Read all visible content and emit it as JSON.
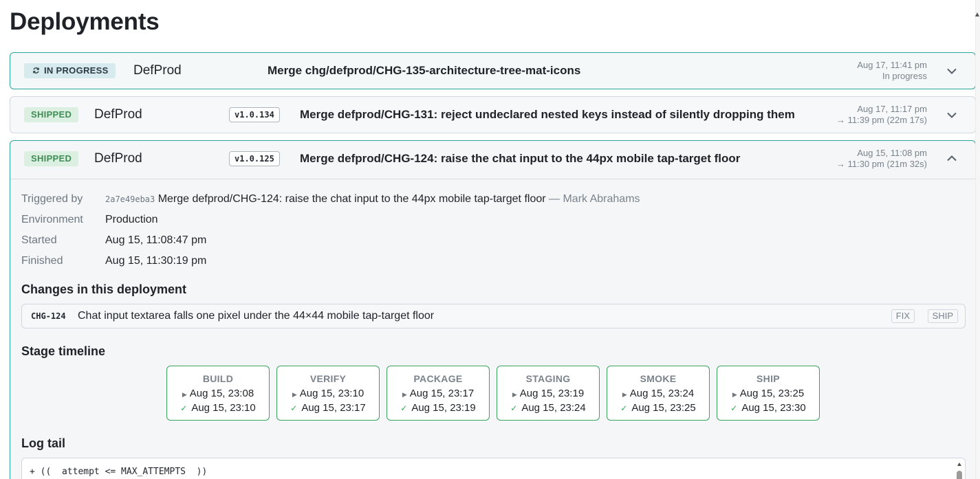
{
  "page": {
    "title": "Deployments"
  },
  "deployments": [
    {
      "status": "IN PROGRESS",
      "project": "DefProd",
      "version": "",
      "message": "Merge chg/defprod/CHG-135-architecture-tree-mat-icons",
      "time_line1": "Aug 17, 11:41 pm",
      "time_line2": "In progress"
    },
    {
      "status": "SHIPPED",
      "project": "DefProd",
      "version": "v1.0.134",
      "message": "Merge defprod/CHG-131: reject undeclared nested keys instead of silently dropping them",
      "time_line1": "Aug 17, 11:17 pm",
      "time_line2": "→ 11:39 pm (22m 17s)"
    },
    {
      "status": "SHIPPED",
      "project": "DefProd",
      "version": "v1.0.125",
      "message": "Merge defprod/CHG-124: raise the chat input to the 44px mobile tap-target floor",
      "time_line1": "Aug 15, 11:08 pm",
      "time_line2": "→ 11:30 pm (21m 32s)"
    }
  ],
  "details": {
    "labels": {
      "triggered_by": "Triggered by",
      "environment": "Environment",
      "started": "Started",
      "finished": "Finished"
    },
    "commit_sha": "2a7e49eba3",
    "commit_message": "Merge defprod/CHG-124: raise the chat input to the 44px mobile tap-target floor",
    "commit_author": "— Mark Abrahams",
    "environment": "Production",
    "started": "Aug 15, 11:08:47 pm",
    "finished": "Aug 15, 11:30:19 pm",
    "changes_heading": "Changes in this deployment",
    "changes": [
      {
        "id": "CHG-124",
        "text": "Chat input textarea falls one pixel under the 44×44 mobile tap-target floor",
        "tags": [
          "FIX",
          "SHIP"
        ]
      }
    ],
    "timeline_heading": "Stage timeline",
    "stages": [
      {
        "name": "BUILD",
        "start": "Aug 15, 23:08",
        "end": "Aug 15, 23:10"
      },
      {
        "name": "VERIFY",
        "start": "Aug 15, 23:10",
        "end": "Aug 15, 23:17"
      },
      {
        "name": "PACKAGE",
        "start": "Aug 15, 23:17",
        "end": "Aug 15, 23:19"
      },
      {
        "name": "STAGING",
        "start": "Aug 15, 23:19",
        "end": "Aug 15, 23:24"
      },
      {
        "name": "SMOKE",
        "start": "Aug 15, 23:24",
        "end": "Aug 15, 23:25"
      },
      {
        "name": "SHIP",
        "start": "Aug 15, 23:25",
        "end": "Aug 15, 23:30"
      }
    ],
    "log_heading": "Log tail",
    "log_lines": [
      "+ ((  attempt <= MAX_ATTEMPTS  ))"
    ]
  },
  "icons": {
    "spinner": "refresh-icon",
    "expand": "chevron-down-icon",
    "collapse": "chevron-up-icon",
    "stage_start": "play-icon",
    "stage_done": "check-icon"
  },
  "colors": {
    "accent_border": "#2ba59a",
    "shipped_bg": "#dcf0e2",
    "shipped_text": "#3f8d55",
    "in_progress_bg": "#d7ebee",
    "stage_border": "#3aa55a"
  }
}
